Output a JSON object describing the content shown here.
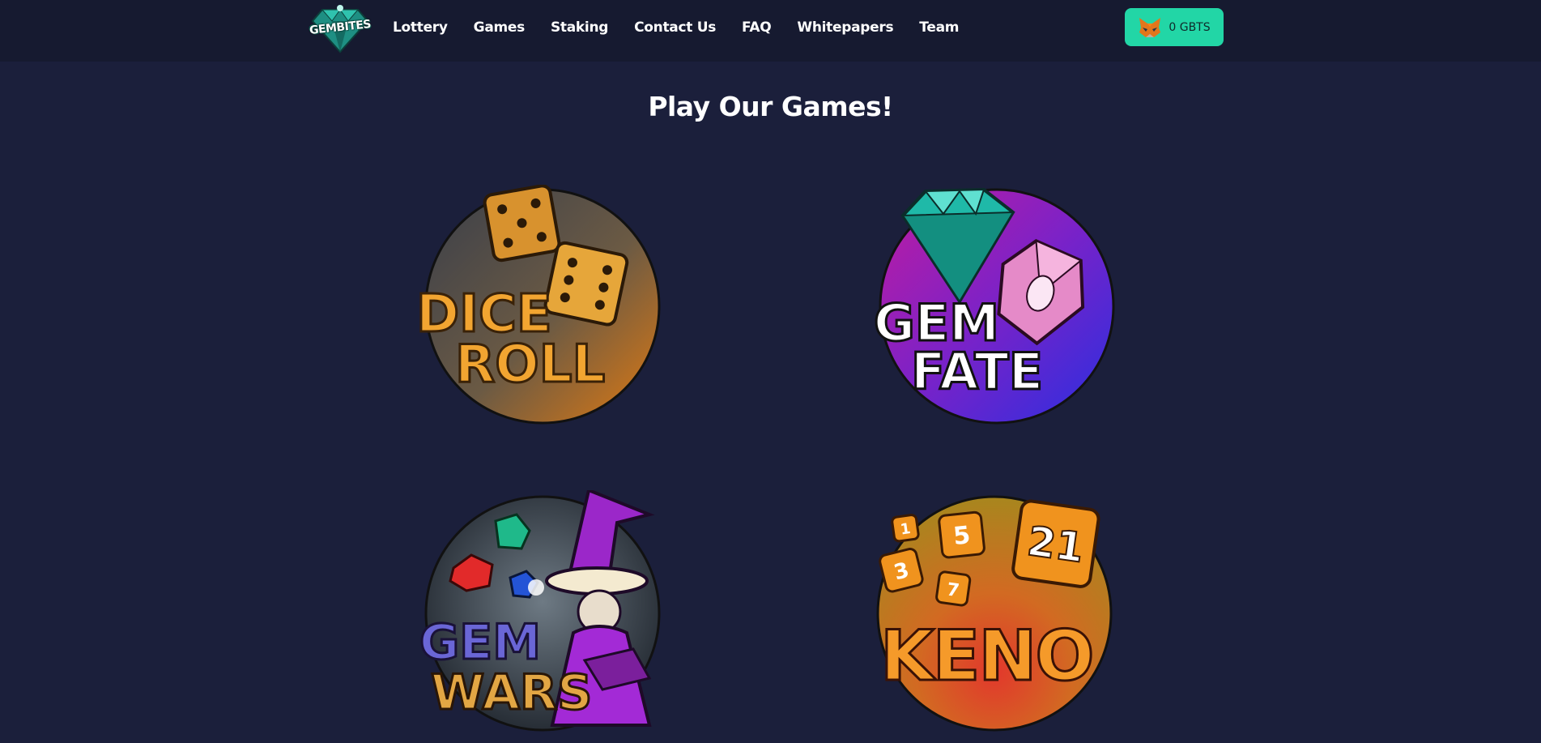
{
  "brand": {
    "logo_text": "GEMBITES"
  },
  "nav": {
    "links": [
      "Lottery",
      "Games",
      "Staking",
      "Contact Us",
      "FAQ",
      "Whitepapers",
      "Team"
    ]
  },
  "wallet": {
    "balance_label": "0 GBTS",
    "icon": "metamask-fox-icon"
  },
  "page": {
    "title": "Play Our Games!"
  },
  "games": [
    {
      "line1": "DICE",
      "line2": "ROLL",
      "icon": "dice-icon"
    },
    {
      "line1": "GEM",
      "line2": "FATE",
      "icon": "diamond-icon"
    },
    {
      "line1": "GEM",
      "line2": "WARS",
      "icon": "wizard-icon"
    },
    {
      "line1": "KENO",
      "numbers": [
        "1",
        "5",
        "3",
        "7",
        "21"
      ],
      "icon": "number-tiles-icon"
    }
  ],
  "colors": {
    "background": "#1b1f3b",
    "navbar": "#161a30",
    "accent": "#22d6a6",
    "dice_orange": "#e07a12",
    "gemfate_purple": "#a318b8",
    "gemfate_blue": "#2a2fe0",
    "keno_orange": "#f0931e"
  }
}
